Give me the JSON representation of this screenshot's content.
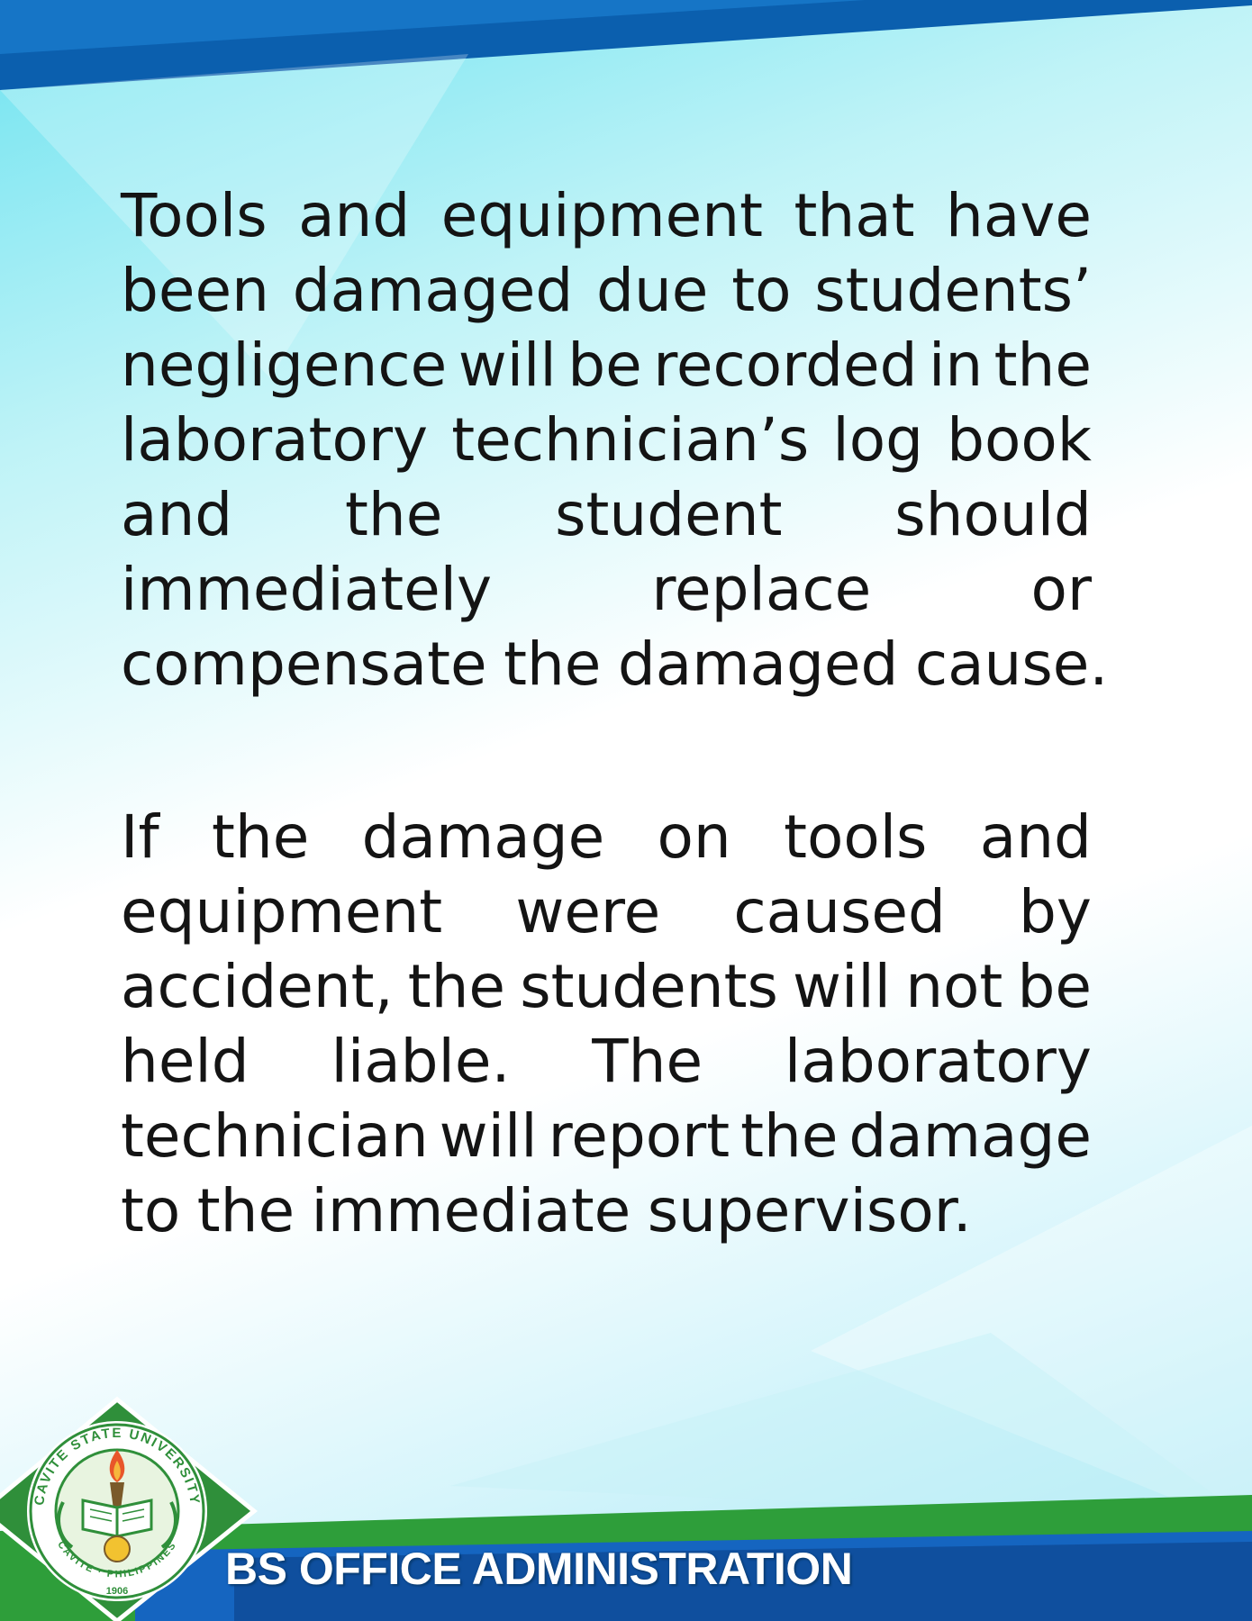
{
  "document": {
    "paragraphs": [
      {
        "lines": [
          [
            "Tools",
            "and",
            "equipment",
            "that",
            "have"
          ],
          [
            "been",
            "damaged",
            "due",
            "to",
            "students’"
          ],
          [
            "negligence",
            "will",
            "be",
            "recorded",
            "in",
            "the"
          ],
          [
            "laboratory",
            "technician’s",
            "log",
            "book"
          ],
          [
            "and",
            "the",
            "student",
            "should"
          ],
          [
            "immediately",
            "replace",
            "or"
          ],
          [
            "compensate",
            "the",
            "damaged",
            "cause."
          ]
        ]
      },
      {
        "lines": [
          [
            "If",
            "the",
            "damage",
            "on",
            "tools",
            "and"
          ],
          [
            "equipment",
            "were",
            "caused",
            "by"
          ],
          [
            "accident,",
            "the",
            "students",
            "will",
            "not",
            "be"
          ],
          [
            "held",
            "liable.",
            "The",
            "laboratory"
          ],
          [
            "technician",
            "will",
            "report",
            "the",
            "damage"
          ],
          [
            "to",
            "the",
            "immediate",
            "supervisor."
          ]
        ]
      }
    ]
  },
  "footer": {
    "program_title": "BS OFFICE ADMINISTRATION"
  },
  "logo": {
    "arc_top": "CAVITE STATE UNIVERSITY",
    "arc_bottom": "CAVITE · PHILIPPINES",
    "year": "1906"
  },
  "colors": {
    "top_band": "#0b63b5",
    "footer_band": "#1565c0",
    "footer_green": "#2e9e3a",
    "logo_green": "#2f8f3a"
  }
}
